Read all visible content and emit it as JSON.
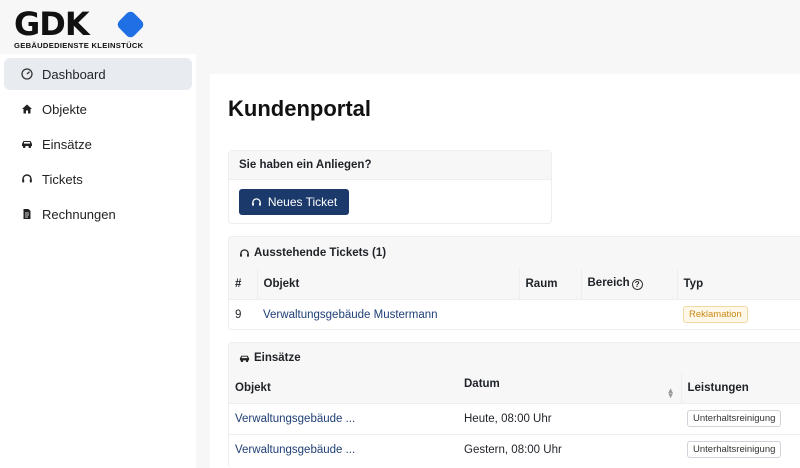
{
  "brand": {
    "logo_text": "GDK",
    "logo_subtitle": "GEBÄUDEDIENSTE KLEINSTÜCK",
    "accent": "#1f6fe5"
  },
  "sidebar": {
    "items": [
      {
        "label": "Dashboard",
        "icon": "gauge-icon",
        "active": true
      },
      {
        "label": "Objekte",
        "icon": "home-icon",
        "active": false
      },
      {
        "label": "Einsätze",
        "icon": "car-icon",
        "active": false
      },
      {
        "label": "Tickets",
        "icon": "headset-icon",
        "active": false
      },
      {
        "label": "Rechnungen",
        "icon": "invoice-icon",
        "active": false
      }
    ]
  },
  "main": {
    "title": "Kundenportal",
    "anliegen": {
      "heading": "Sie haben ein Anliegen?",
      "button_label": "Neues Ticket"
    },
    "tickets": {
      "heading": "Ausstehende Tickets (1)",
      "columns": [
        "#",
        "Objekt",
        "Raum",
        "Bereich",
        "Typ"
      ],
      "rows": [
        {
          "id": "9",
          "objekt": "Verwaltungsgebäude Mustermann",
          "raum": "",
          "bereich": "",
          "typ": "Reklamation"
        }
      ]
    },
    "einsaetze": {
      "heading": "Einsätze",
      "columns": [
        "Objekt",
        "Datum",
        "Leistungen"
      ],
      "rows": [
        {
          "objekt": "Verwaltungsgebäude ...",
          "datum": "Heute, 08:00 Uhr",
          "leistung": "Unterhaltsreinigung"
        },
        {
          "objekt": "Verwaltungsgebäude ...",
          "datum": "Gestern, 08:00 Uhr",
          "leistung": "Unterhaltsreinigung"
        }
      ]
    }
  },
  "colors": {
    "primary_button": "#1b3a6b",
    "link": "#1f3f75",
    "badge_warning": "#c98a18"
  }
}
